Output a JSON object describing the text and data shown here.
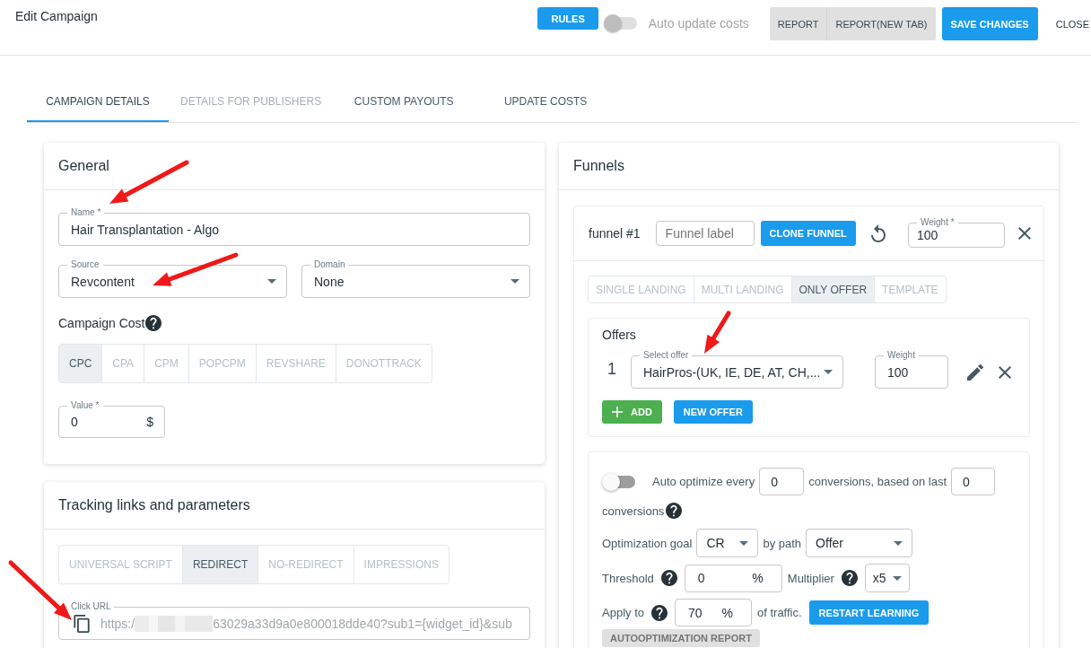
{
  "header": {
    "title": "Edit Campaign",
    "rules_button": "RULES",
    "auto_update": {
      "label": "Auto update costs",
      "on": false
    },
    "report_buttons": [
      "REPORT",
      "REPORT(NEW TAB)"
    ],
    "save_button": "SAVE CHANGES",
    "close_button": "CLOSE"
  },
  "tabs": [
    {
      "label": "CAMPAIGN DETAILS",
      "selected": true,
      "disabled": false
    },
    {
      "label": "DETAILS FOR PUBLISHERS",
      "selected": false,
      "disabled": true
    },
    {
      "label": "CUSTOM PAYOUTS",
      "selected": false,
      "disabled": false
    },
    {
      "label": "UPDATE COSTS",
      "selected": false,
      "disabled": false
    }
  ],
  "general": {
    "title": "General",
    "name": {
      "label": "Name *",
      "value": "Hair Transplantation - Algo",
      "arrow": true
    },
    "source": {
      "label": "Source",
      "value": "Revcontent",
      "arrow": true
    },
    "domain": {
      "label": "Domain",
      "value": "None"
    },
    "cost_title": "Campaign Cost",
    "cost_types": [
      {
        "label": "CPC",
        "selected": true
      },
      {
        "label": "CPA",
        "selected": false
      },
      {
        "label": "CPM",
        "selected": false
      },
      {
        "label": "POPCPM",
        "selected": false
      },
      {
        "label": "REVSHARE",
        "selected": false
      },
      {
        "label": "DONOTTRACK",
        "selected": false
      }
    ],
    "cost_value": {
      "label": "Value *",
      "value": "0",
      "unit": "$"
    }
  },
  "tracking": {
    "title": "Tracking links and parameters",
    "modes": [
      {
        "label": "UNIVERSAL SCRIPT",
        "selected": false
      },
      {
        "label": "REDIRECT",
        "selected": true
      },
      {
        "label": "NO-REDIRECT",
        "selected": false
      },
      {
        "label": "IMPRESSIONS",
        "selected": false
      }
    ],
    "click_url": {
      "label": "Click URL",
      "value_start": "https:/",
      "value_end": "63029a33d9a0e800018dde40?sub1={widget_id}&sub",
      "redacted": true,
      "arrow": true
    }
  },
  "funnels": {
    "title": "Funnels",
    "funnel": {
      "name": "funnel #1",
      "label_placeholder": "Funnel label",
      "clone_button": "CLONE FUNNEL",
      "weight": {
        "label": "Weight *",
        "value": "100"
      },
      "types": [
        {
          "label": "SINGLE LANDING",
          "selected": false
        },
        {
          "label": "MULTI LANDING",
          "selected": false
        },
        {
          "label": "ONLY OFFER",
          "selected": true
        },
        {
          "label": "TEMPLATE",
          "selected": false
        }
      ],
      "offers": {
        "title": "Offers",
        "rows": [
          {
            "number": "1",
            "offer": {
              "label": "Select offer",
              "value": "HairPros-(UK, IE, DE, AT, CH,...",
              "arrow": true
            },
            "weight": {
              "label": "Weight",
              "value": "100"
            }
          }
        ],
        "add_button": "ADD",
        "new_offer_button": "NEW OFFER"
      },
      "optimization": {
        "auto_optimize": {
          "on": false,
          "text_before": "Auto optimize every",
          "every": "0",
          "text_middle": "conversions, based on last",
          "last": "0",
          "text_after": "conversions"
        },
        "goal": {
          "label": "Optimization goal",
          "value": "CR",
          "path_label": "by path",
          "path_value": "Offer"
        },
        "threshold": {
          "label": "Threshold",
          "value": "0",
          "unit": "%",
          "multiplier_label": "Multiplier",
          "multiplier_value": "x5"
        },
        "apply": {
          "label": "Apply to",
          "value": "70",
          "unit": "%",
          "suffix": "of traffic.",
          "restart_button": "RESTART LEARNING"
        },
        "report_button": {
          "label": "AUTOOPTIMIZATION REPORT",
          "disabled": true
        }
      }
    }
  }
}
